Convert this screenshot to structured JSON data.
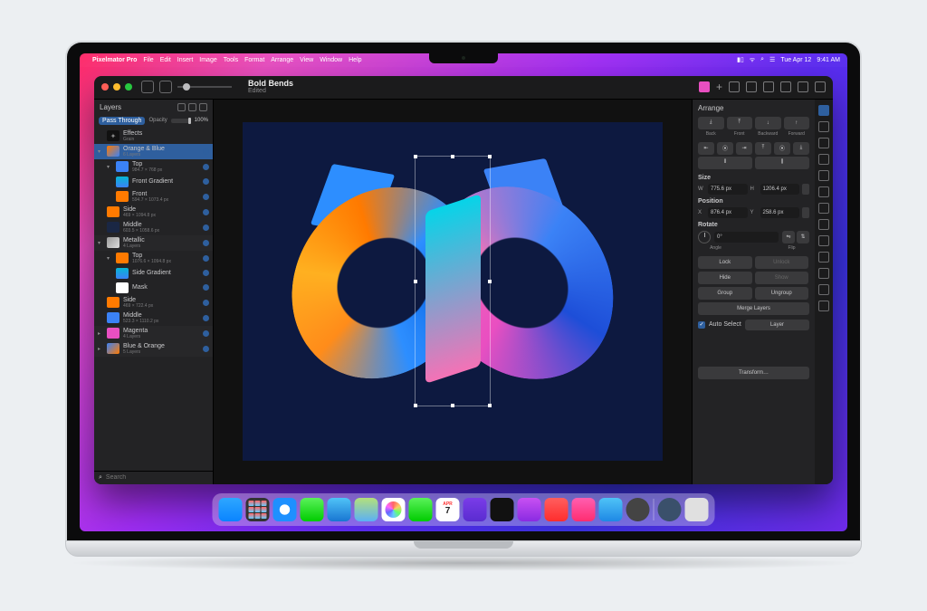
{
  "menubar": {
    "app": "Pixelmator Pro",
    "items": [
      "File",
      "Edit",
      "Insert",
      "Image",
      "Tools",
      "Format",
      "Arrange",
      "View",
      "Window",
      "Help"
    ],
    "date": "Tue Apr 12",
    "time": "9:41 AM"
  },
  "titlebar": {
    "doc": "Bold Bends",
    "sub": "Edited"
  },
  "layers": {
    "title": "Layers",
    "blend": "Pass Through",
    "opacity_label": "Opacity",
    "opacity": "100%",
    "search_placeholder": "Search",
    "items": [
      {
        "name": "Effects",
        "sub": "Grain",
        "type": "fx"
      },
      {
        "name": "Orange & Blue",
        "sub": "6 Layers",
        "type": "group",
        "sel": true
      },
      {
        "name": "Top",
        "sub": "984.7 × 768 px",
        "type": "child"
      },
      {
        "name": "Front Gradient",
        "sub": "",
        "type": "child2"
      },
      {
        "name": "Front",
        "sub": "594.7 × 1073.4 px",
        "type": "child2"
      },
      {
        "name": "Side",
        "sub": "469 × 1094.8 px",
        "type": "child"
      },
      {
        "name": "Middle",
        "sub": "603.5 × 1058.6 px",
        "type": "child"
      },
      {
        "name": "Metallic",
        "sub": "4 Layers",
        "type": "group2"
      },
      {
        "name": "Top",
        "sub": "1076.6 × 1094.8 px",
        "type": "child"
      },
      {
        "name": "Side Gradient",
        "sub": "",
        "type": "child2"
      },
      {
        "name": "Mask",
        "sub": "",
        "type": "child2"
      },
      {
        "name": "Side",
        "sub": "469 × 722.4 px",
        "type": "child"
      },
      {
        "name": "Middle",
        "sub": "523.3 × 1110.2 px",
        "type": "child"
      },
      {
        "name": "Magenta",
        "sub": "4 Layers",
        "type": "group2"
      },
      {
        "name": "Blue & Orange",
        "sub": "5 Layers",
        "type": "group2"
      }
    ]
  },
  "arrange": {
    "title": "Arrange",
    "order": [
      "Back",
      "Front",
      "Backward",
      "Forward"
    ],
    "size_label": "Size",
    "w": "775.6 px",
    "h": "1206.4 px",
    "pos_label": "Position",
    "x": "876.4 px",
    "y": "258.6 px",
    "rotate_label": "Rotate",
    "angle": "Angle",
    "flip": "Flip",
    "lock": "Lock",
    "unlock": "Unlock",
    "hide": "Hide",
    "show": "Show",
    "group": "Group",
    "ungroup": "Ungroup",
    "merge": "Merge Layers",
    "auto_select": "Auto Select",
    "auto_value": "Layer",
    "transform": "Transform…"
  },
  "dock": {
    "cal_month": "APR",
    "cal_day": "7"
  }
}
